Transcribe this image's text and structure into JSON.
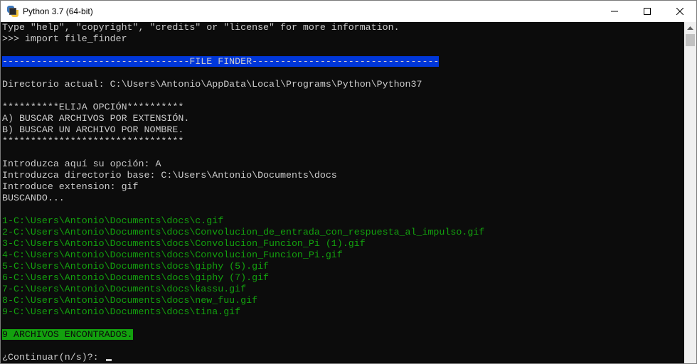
{
  "window": {
    "title": "Python 3.7 (64-bit)"
  },
  "terminal": {
    "lines": [
      {
        "text": "Type \"help\", \"copyright\", \"credits\" or \"license\" for more information.",
        "style": "normal"
      },
      {
        "text": ">>> import file_finder",
        "style": "normal"
      },
      {
        "text": "",
        "style": "normal"
      },
      {
        "text": "---------------------------------FILE FINDER---------------------------------",
        "style": "hl-blue"
      },
      {
        "text": "",
        "style": "normal"
      },
      {
        "text": "Directorio actual: C:\\Users\\Antonio\\AppData\\Local\\Programs\\Python\\Python37",
        "style": "normal"
      },
      {
        "text": "",
        "style": "normal"
      },
      {
        "text": "**********ELIJA OPCIÓN**********",
        "style": "normal"
      },
      {
        "text": "A) BUSCAR ARCHIVOS POR EXTENSIÓN.",
        "style": "normal"
      },
      {
        "text": "B) BUSCAR UN ARCHIVO POR NOMBRE.",
        "style": "normal"
      },
      {
        "text": "********************************",
        "style": "normal"
      },
      {
        "text": "",
        "style": "normal"
      },
      {
        "text": "Introduzca aquí su opción: A",
        "style": "normal"
      },
      {
        "text": "Introduzca directorio base: C:\\Users\\Antonio\\Documents\\docs",
        "style": "normal"
      },
      {
        "text": "Introduce extension: gif",
        "style": "normal"
      },
      {
        "text": "BUSCANDO...",
        "style": "normal"
      },
      {
        "text": "",
        "style": "normal"
      },
      {
        "text": "1-C:\\Users\\Antonio\\Documents\\docs\\c.gif",
        "style": "green"
      },
      {
        "text": "2-C:\\Users\\Antonio\\Documents\\docs\\Convolucion_de_entrada_con_respuesta_al_impulso.gif",
        "style": "green"
      },
      {
        "text": "3-C:\\Users\\Antonio\\Documents\\docs\\Convolucion_Funcion_Pi (1).gif",
        "style": "green"
      },
      {
        "text": "4-C:\\Users\\Antonio\\Documents\\docs\\Convolucion_Funcion_Pi.gif",
        "style": "green"
      },
      {
        "text": "5-C:\\Users\\Antonio\\Documents\\docs\\giphy (5).gif",
        "style": "green"
      },
      {
        "text": "6-C:\\Users\\Antonio\\Documents\\docs\\giphy (7).gif",
        "style": "green"
      },
      {
        "text": "7-C:\\Users\\Antonio\\Documents\\docs\\kassu.gif",
        "style": "green"
      },
      {
        "text": "8-C:\\Users\\Antonio\\Documents\\docs\\new_fuu.gif",
        "style": "green"
      },
      {
        "text": "9-C:\\Users\\Antonio\\Documents\\docs\\tina.gif",
        "style": "green"
      },
      {
        "text": "",
        "style": "normal"
      },
      {
        "text": "9 ARCHIVOS ENCONTRADOS.",
        "style": "hl-green"
      },
      {
        "text": "",
        "style": "normal"
      }
    ],
    "prompt": "¿Continuar(n/s)?: "
  },
  "colors": {
    "terminal_bg": "#0c0c0c",
    "terminal_fg": "#cccccc",
    "highlight_blue": "#0037da",
    "highlight_green": "#13a10e",
    "green_text": "#13a10e"
  },
  "icons": {
    "app": "python-console-icon",
    "minimize": "minimize-icon",
    "maximize": "maximize-icon",
    "close": "close-icon",
    "scroll_up": "scroll-up-arrow-icon"
  }
}
